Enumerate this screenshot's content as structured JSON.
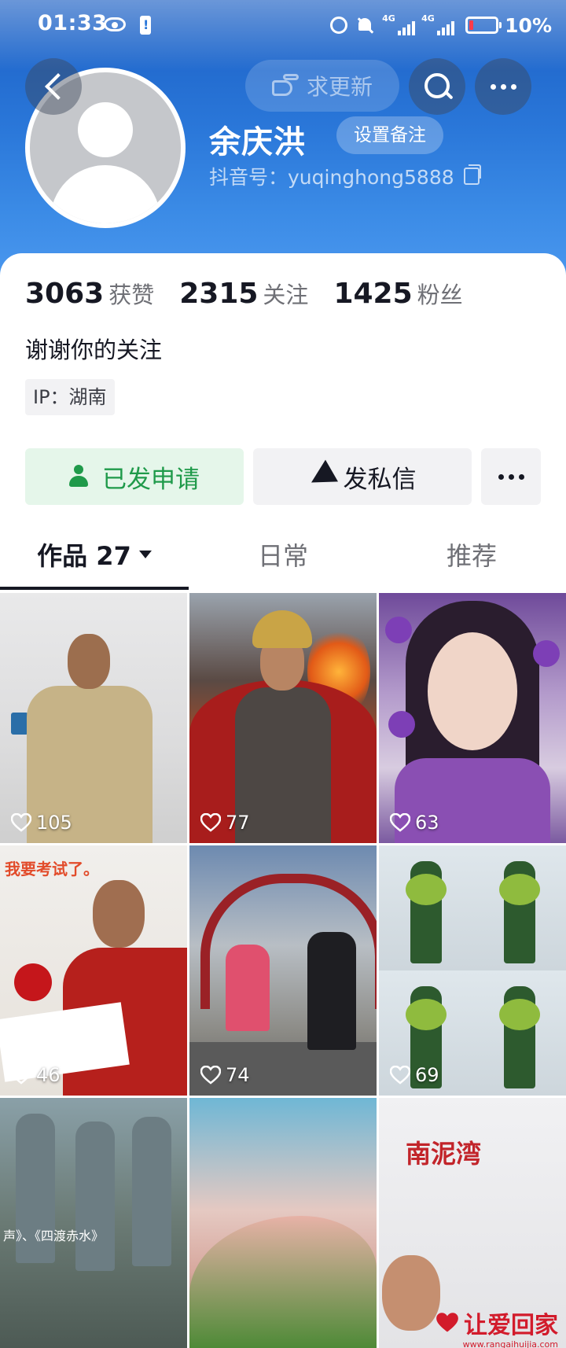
{
  "status_bar": {
    "time": "01:33",
    "network_1": "4G",
    "network_2": "4G",
    "battery": "10%"
  },
  "header": {
    "update_label": "求更新",
    "nickname": "余庆洪",
    "remark_label": "设置备注",
    "douyin_id": "抖音号：yuqinghong5888"
  },
  "stats": [
    {
      "value": "3063",
      "label": "获赞"
    },
    {
      "value": "2315",
      "label": "关注"
    },
    {
      "value": "1425",
      "label": "粉丝"
    }
  ],
  "bio": "谢谢你的关注",
  "ip": "IP：湖南",
  "actions": {
    "applied_label": "已发申请",
    "message_label": "发私信"
  },
  "tabs": {
    "works": "作品 27",
    "daily": "日常",
    "recommended": "推荐"
  },
  "videos": [
    {
      "likes": "105"
    },
    {
      "likes": "77"
    },
    {
      "likes": "63"
    },
    {
      "likes": "46",
      "caption": "我要考试了。"
    },
    {
      "likes": "74"
    },
    {
      "likes": "69"
    },
    {
      "caption": "声》、《四渡赤水》"
    },
    {},
    {
      "caption": "南泥湾",
      "watermark": "让爱回家",
      "watermark_url": "www.rangaihuijia.com"
    }
  ],
  "colors": {
    "cover_blue": "#2a77d9",
    "applied_green": "#1f9a4a",
    "text_primary": "#161823",
    "text_secondary": "#6f7076"
  }
}
